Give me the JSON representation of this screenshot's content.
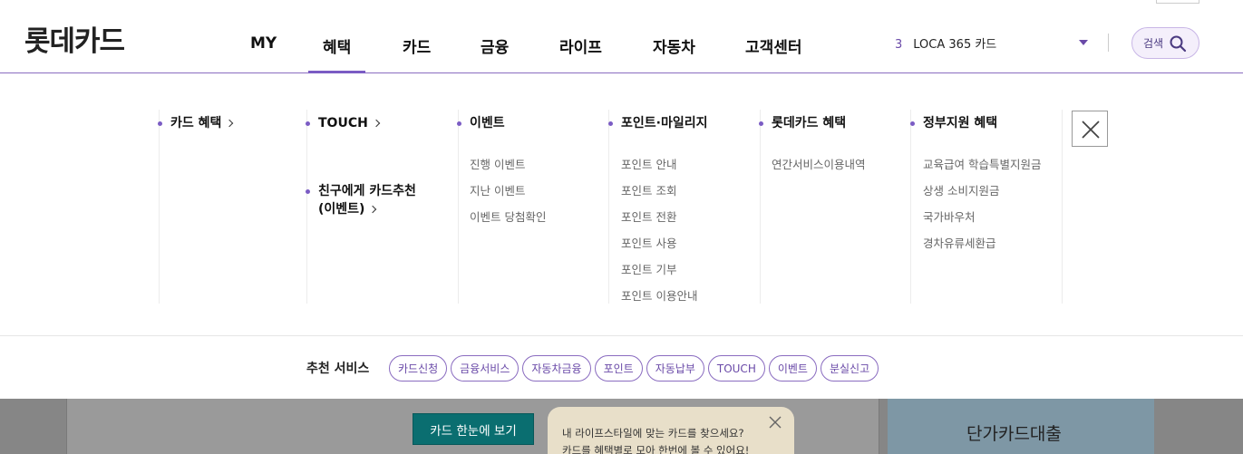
{
  "logo": "롯데카드",
  "gnb": [
    {
      "label": "MY",
      "active": false
    },
    {
      "label": "혜택",
      "active": true
    },
    {
      "label": "카드",
      "active": false
    },
    {
      "label": "금융",
      "active": false
    },
    {
      "label": "라이프",
      "active": false
    },
    {
      "label": "자동차",
      "active": false
    },
    {
      "label": "고객센터",
      "active": false
    }
  ],
  "card_select": {
    "number": "3",
    "name": "LOCA 365 카드"
  },
  "search": {
    "label": "검색"
  },
  "accent_color": "#7b5cc4",
  "mega_menu": {
    "col1": {
      "cat1": "카드 혜택"
    },
    "col2": {
      "cat1": "TOUCH",
      "cat2_line1": "친구에게 카드추천",
      "cat2_line2": "(이벤트)"
    },
    "col3": {
      "title": "이벤트",
      "items": [
        "진행 이벤트",
        "지난 이벤트",
        "이벤트 당첨확인"
      ]
    },
    "col4": {
      "title": "포인트·마일리지",
      "items": [
        "포인트 안내",
        "포인트 조회",
        "포인트 전환",
        "포인트 사용",
        "포인트 기부",
        "포인트 이용안내"
      ]
    },
    "col5": {
      "title": "롯데카드 혜택",
      "items": [
        "연간서비스이용내역"
      ]
    },
    "col6": {
      "title": "정부지원 혜택",
      "items": [
        "교육급여 학습특별지원금",
        "상생 소비지원금",
        "국가바우처",
        "경차유류세환급"
      ]
    }
  },
  "recommend": {
    "title": "추천 서비스",
    "chips": [
      "카드신청",
      "금융서비스",
      "자동차금융",
      "포인트",
      "자동납부",
      "TOUCH",
      "이벤트",
      "분실신고"
    ]
  },
  "background": {
    "button": "카드 한눈에 보기",
    "tooltip_line1": "내 라이프스타일에 맞는 카드를 찾으세요?",
    "tooltip_line2": "카드를 혜택별로 모아 한번에 볼 수 있어요!",
    "right_title": "단가카드대출"
  }
}
